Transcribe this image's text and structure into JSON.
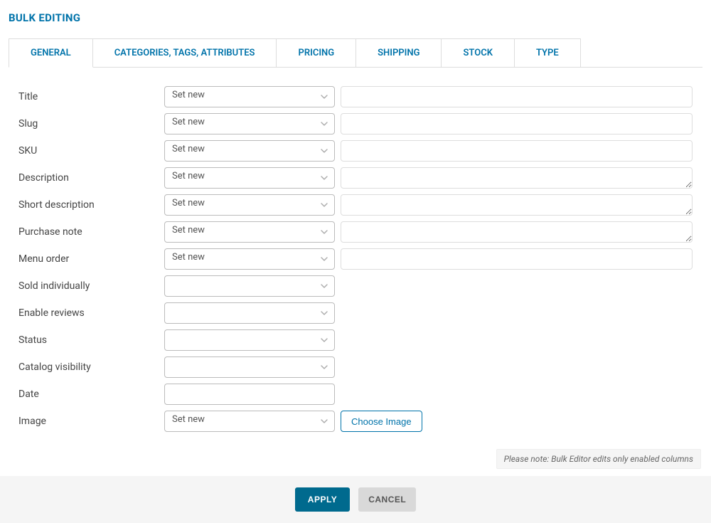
{
  "header": {
    "title": "BULK EDITING"
  },
  "tabs": {
    "general": "GENERAL",
    "categories": "CATEGORIES, TAGS, ATTRIBUTES",
    "pricing": "PRICING",
    "shipping": "SHIPPING",
    "stock": "STOCK",
    "type": "TYPE"
  },
  "options": {
    "set_new": "Set new",
    "empty": ""
  },
  "fields": {
    "title": "Title",
    "slug": "Slug",
    "sku": "SKU",
    "description": "Description",
    "short_description": "Short description",
    "purchase_note": "Purchase note",
    "menu_order": "Menu order",
    "sold_individually": "Sold individually",
    "enable_reviews": "Enable reviews",
    "status": "Status",
    "catalog_visibility": "Catalog visibility",
    "date": "Date",
    "image": "Image"
  },
  "buttons": {
    "choose_image": "Choose Image",
    "apply": "APPLY",
    "cancel": "CANCEL"
  },
  "note": "Please note: Bulk Editor edits only enabled columns"
}
